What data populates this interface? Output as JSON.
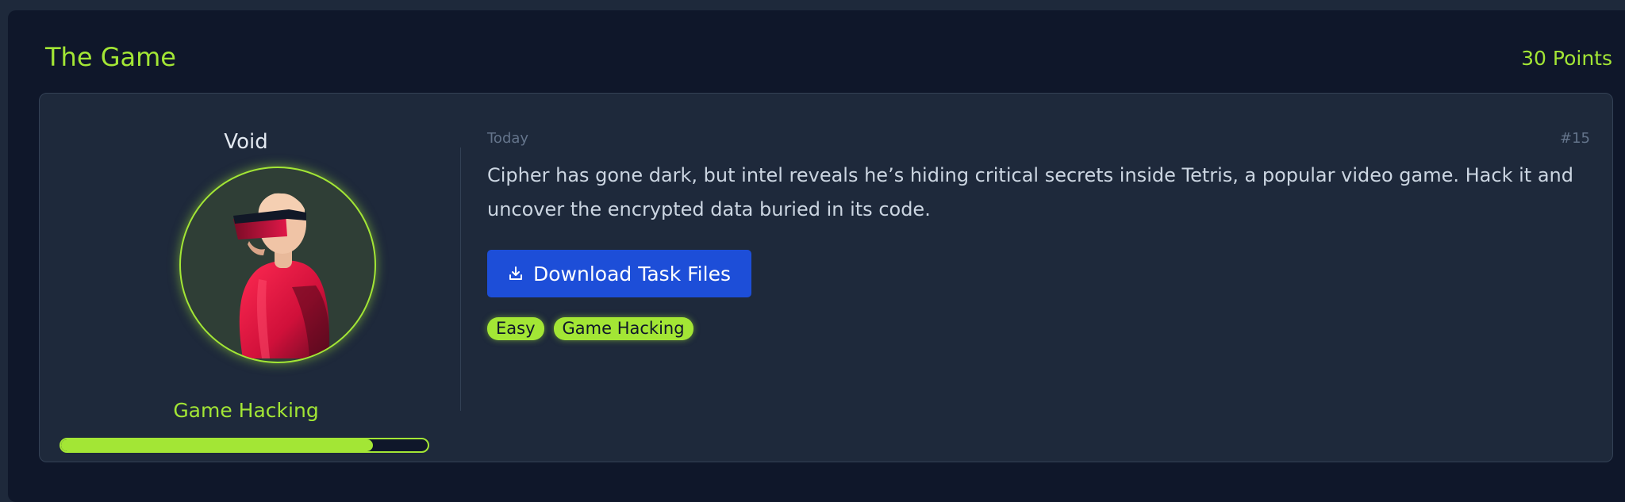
{
  "challenge": {
    "title": "The Game",
    "points": "30 Points"
  },
  "author": {
    "name": "Void",
    "avatar_icon": "hacker-avatar-icon",
    "category": "Game Hacking",
    "progress_fraction": 0.85
  },
  "post": {
    "date": "Today",
    "number": "#15",
    "description": "Cipher has gone dark, but intel reveals he’s hiding critical secrets inside Tetris, a popular video game. Hack it and uncover the encrypted data buried in its code.",
    "download_label": "Download Task Files",
    "download_icon": "download-icon",
    "tags": [
      "Easy",
      "Game Hacking"
    ]
  },
  "colors": {
    "accent": "#a3e635",
    "button": "#1d4ed8",
    "background": "#0f172a",
    "card": "#1e293b"
  }
}
